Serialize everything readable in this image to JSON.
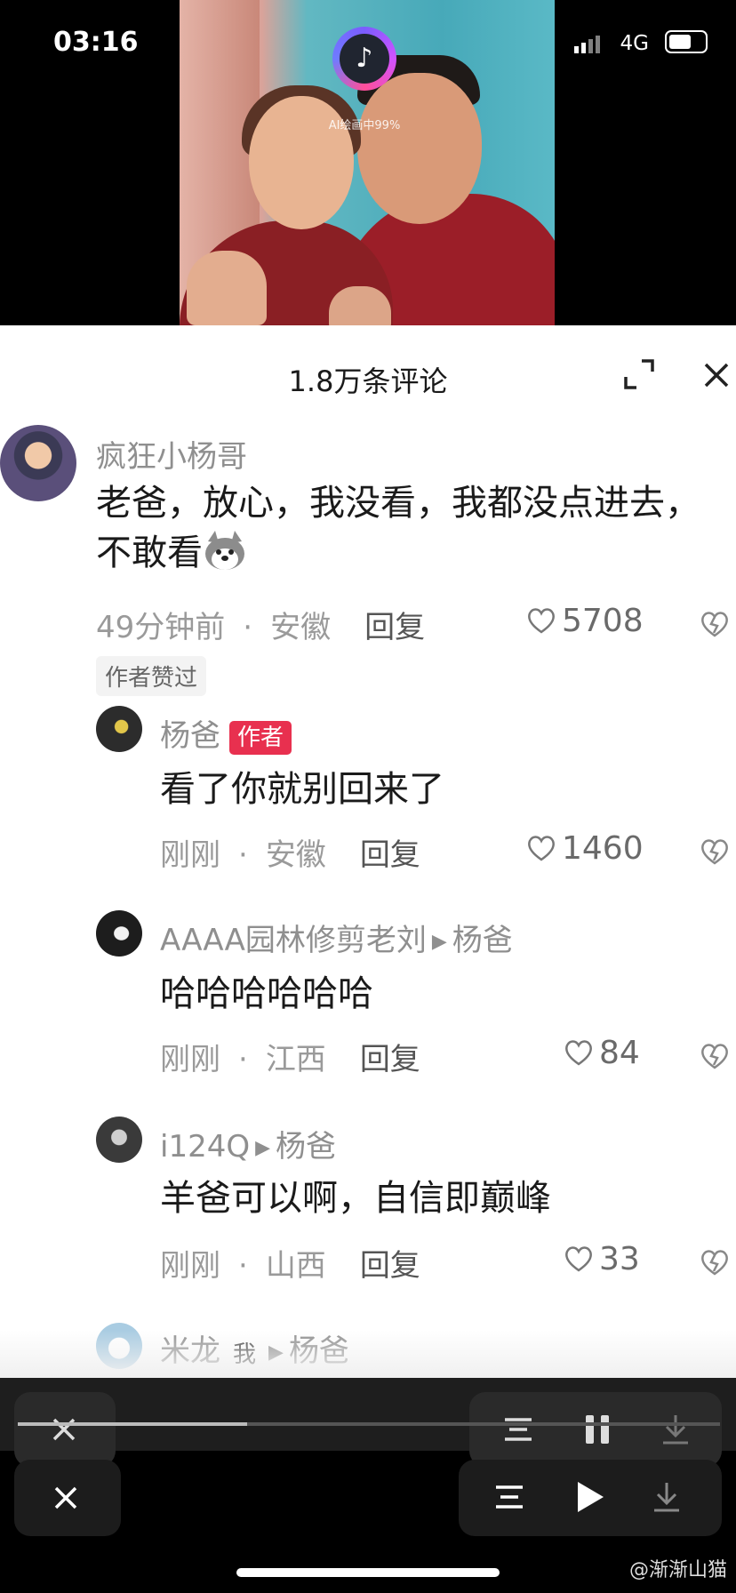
{
  "status_bar": {
    "time": "03:16",
    "network": "4G"
  },
  "video": {
    "ai_label": "AI绘画中99%"
  },
  "comments_panel": {
    "title": "1.8万条评论",
    "comments": [
      {
        "user": "疯狂小杨哥",
        "text": "老爸，放心，我没看，我都没点进去，不敢看",
        "emoji": "doge-emoji",
        "time": "49分钟前",
        "location": "安徽",
        "reply_label": "回复",
        "likes": "5708",
        "tag": "作者赞过"
      },
      {
        "user": "杨爸",
        "badge": "作者",
        "text": "看了你就别回来了",
        "time": "刚刚",
        "location": "安徽",
        "reply_label": "回复",
        "likes": "1460"
      },
      {
        "user": "AAAA园林修剪老刘",
        "reply_to": "杨爸",
        "text": "哈哈哈哈哈哈",
        "time": "刚刚",
        "location": "江西",
        "reply_label": "回复",
        "likes": "84"
      },
      {
        "user": "i124Q",
        "reply_to": "杨爸",
        "text": "羊爸可以啊，自信即巅峰",
        "time": "刚刚",
        "location": "山西",
        "reply_label": "回复",
        "likes": "33"
      },
      {
        "user": "米龙",
        "badge": "我",
        "reply_to": "杨爸"
      }
    ],
    "separator": "·"
  },
  "controls": {
    "close_icon": "close-icon",
    "list_icon": "list-icon",
    "pause_icon": "pause-icon",
    "play_icon": "play-icon",
    "download_icon": "download-icon"
  },
  "watermark": "@渐渐山猫"
}
